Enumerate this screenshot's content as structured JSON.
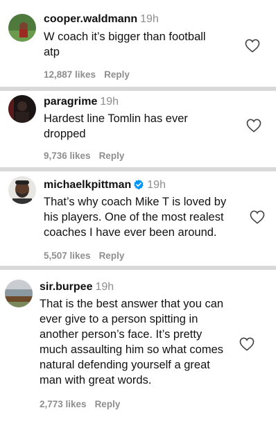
{
  "comments": [
    {
      "username": "cooper.waldmann",
      "time": "19h",
      "verified": false,
      "lines": [
        "W coach it’s bigger than football",
        "atp"
      ],
      "likes": "12,887 likes",
      "reply": "Reply"
    },
    {
      "username": "paragrime",
      "time": "19h",
      "verified": false,
      "lines": [
        "Hardest line Tomlin has ever",
        "dropped"
      ],
      "likes": "9,736 likes",
      "reply": "Reply"
    },
    {
      "username": "michaelkpittman",
      "time": "19h",
      "verified": true,
      "lines": [
        "That’s why coach Mike T is loved by",
        "his players. One of the most realest",
        "coaches I have ever been around."
      ],
      "likes": "5,507 likes",
      "reply": "Reply"
    },
    {
      "username": "sir.burpee",
      "time": "19h",
      "verified": false,
      "lines": [
        "That is the best answer that you can",
        "ever give to a person spitting in",
        "another person’s face. It’s pretty",
        "much assaulting him so what comes",
        "natural defending yourself a great",
        "man with great words."
      ],
      "likes": "2,773 likes",
      "reply": "Reply"
    }
  ],
  "colors": {
    "verified_blue": "#0095f6",
    "muted": "#8e8e8e",
    "divider": "#d9d9d9"
  },
  "icons": {
    "like": "heart-outline-icon",
    "verified": "verified-badge-icon"
  }
}
